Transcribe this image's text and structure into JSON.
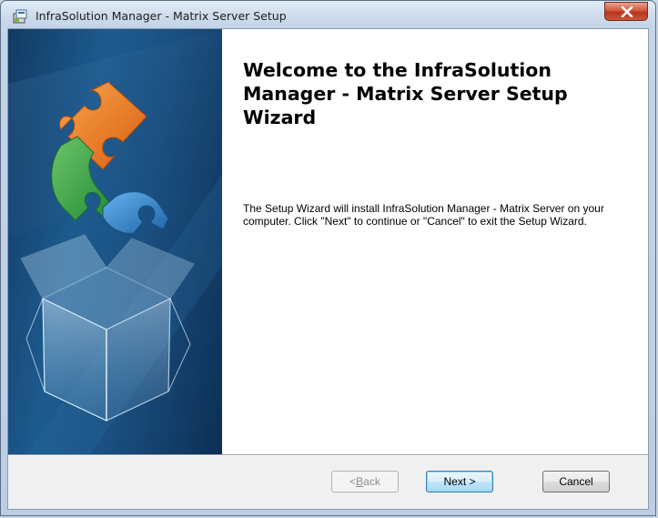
{
  "window": {
    "title": "InfraSolution Manager - Matrix Server Setup",
    "icon": "installer-package-icon",
    "close_icon": "close-x-icon"
  },
  "banner": {
    "image": "puzzle-piece-box-illustration",
    "colors": {
      "background": "#1a4f80",
      "puzzle_orange": "#e8731e",
      "puzzle_green": "#3aa24a",
      "puzzle_blue": "#2f7fc9"
    }
  },
  "content": {
    "heading": "Welcome to the InfraSolution Manager - Matrix Server Setup Wizard",
    "description": "The Setup Wizard will install InfraSolution Manager - Matrix Server on your computer.  Click \"Next\" to continue or \"Cancel\" to exit the Setup Wizard."
  },
  "buttons": {
    "back_prefix": "< ",
    "back_mnemonic": "B",
    "back_rest": "ack",
    "back_enabled": false,
    "next_label": "Next >",
    "cancel_label": "Cancel"
  }
}
